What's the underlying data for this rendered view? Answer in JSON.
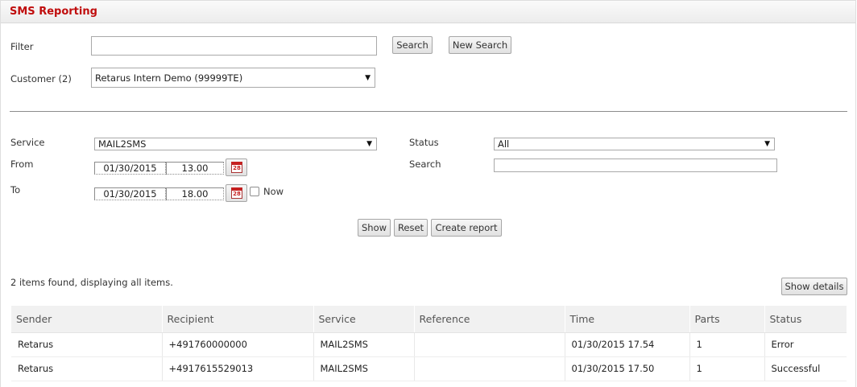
{
  "header": {
    "title": "SMS Reporting"
  },
  "filter": {
    "label": "Filter",
    "value": "",
    "search_label": "Search",
    "new_search_label": "New Search"
  },
  "customer": {
    "label": "Customer (2)",
    "selected": "Retarus Intern Demo (99999TE)"
  },
  "query": {
    "service_label": "Service",
    "service_value": "MAIL2SMS",
    "status_label": "Status",
    "status_value": "All",
    "from_label": "From",
    "from_date": "01/30/2015",
    "from_time": "13.00",
    "to_label": "To",
    "to_date": "01/30/2015",
    "to_time": "18.00",
    "now_label": "Now",
    "search_label": "Search",
    "search_value": "",
    "calendar_day": "28"
  },
  "actions": {
    "show_label": "Show",
    "reset_label": "Reset",
    "report_label": "Create report"
  },
  "results": {
    "summary": "2 items found, displaying all items.",
    "show_details_label": "Show details",
    "columns": [
      "Sender",
      "Recipient",
      "Service",
      "Reference",
      "Time",
      "Parts",
      "Status"
    ],
    "rows": [
      [
        "Retarus",
        "+491760000000",
        "MAIL2SMS",
        "",
        "01/30/2015 17.54",
        "1",
        "Error"
      ],
      [
        "Retarus",
        "+4917615529013",
        "MAIL2SMS",
        "",
        "01/30/2015 17.50",
        "1",
        "Successful"
      ]
    ]
  },
  "colors": {
    "title": "#c00d0d",
    "header_bg": "#f1f1f1"
  }
}
